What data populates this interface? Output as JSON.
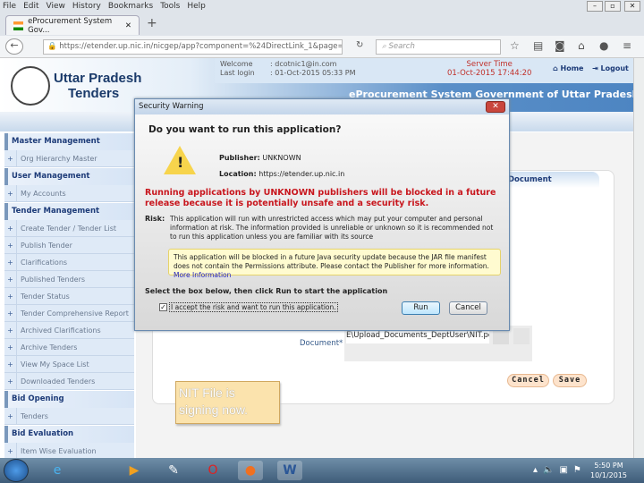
{
  "browser": {
    "menu": [
      "File",
      "Edit",
      "View",
      "History",
      "Bookmarks",
      "Tools",
      "Help"
    ],
    "tab_title": "eProcurement System Gov...",
    "url": "https://etender.up.nic.in/nicgep/app?component=%24DirectLink_1&page=Tend",
    "search_placeholder": "Search"
  },
  "header": {
    "brand_line1": "Uttar Pradesh",
    "brand_line2": "Tenders",
    "welcome_label": "Welcome",
    "welcome_value": ": dcotnic1@in.com",
    "last_login_label": "Last login",
    "last_login_value": ": 01-Oct-2015 05:33 PM",
    "server_time_label": "Server Time",
    "server_time_value": "01-Oct-2015 17:44:20",
    "home": "Home",
    "logout": "Logout",
    "system_title": "eProcurement System Government of Uttar Pradesh"
  },
  "sidebar": {
    "sections": [
      {
        "title": "Master Management",
        "items": [
          "Org Hierarchy Master"
        ]
      },
      {
        "title": "User Management",
        "items": [
          "My Accounts"
        ]
      },
      {
        "title": "Tender Management",
        "items": [
          "Create Tender / Tender List",
          "Publish Tender",
          "Clarifications",
          "Published Tenders",
          "Tender Status",
          "Tender Comprehensive Report",
          "Archived Clarifications",
          "Archive Tenders",
          "View My Space List",
          "Downloaded Tenders"
        ]
      },
      {
        "title": "Bid Opening",
        "items": [
          "Tenders"
        ]
      },
      {
        "title": "Bid Evaluation",
        "items": [
          "Item Wise Evaluation"
        ]
      }
    ]
  },
  "content": {
    "tab": "Document",
    "document_label": "Document*",
    "document_value": "E\\Upload_Documents_DeptUser\\NIT.pdf",
    "cancel": "Cancel",
    "save": "Save"
  },
  "note": "NIT File is signing now.",
  "dialog": {
    "title": "Security Warning",
    "question": "Do you want to run this application?",
    "publisher_label": "Publisher:",
    "publisher_value": "UNKNOWN",
    "location_label": "Location:",
    "location_value": "https://etender.up.nic.in",
    "warning": "Running applications by UNKNOWN publishers will be blocked in a future release because it is potentially unsafe and a security risk.",
    "risk_label": "Risk:",
    "risk_text": "This application will run with unrestricted access which may put your computer and personal information at risk. The information provided is unreliable or unknown so it is recommended not to run this application unless you are familiar with its source",
    "info_text": "This application will be blocked in a future Java security update because the JAR file manifest does not contain the Permissions attribute. Please contact the Publisher for more information.",
    "more_info": "More Information",
    "instruction": "Select the box below, then click Run to start the application",
    "checkbox_label": "I accept the risk and want to run this application.",
    "checkbox_checked": true,
    "run": "Run",
    "cancel": "Cancel"
  },
  "taskbar": {
    "time": "5:50 PM",
    "date": "10/1/2015"
  }
}
